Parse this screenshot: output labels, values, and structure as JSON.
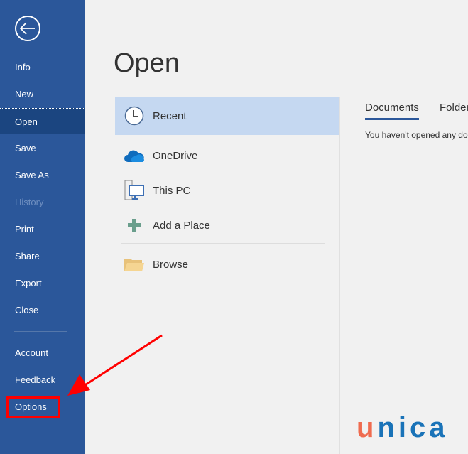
{
  "sidebar": {
    "items": [
      {
        "label": "Info"
      },
      {
        "label": "New"
      },
      {
        "label": "Open",
        "active": true
      },
      {
        "label": "Save"
      },
      {
        "label": "Save As"
      },
      {
        "label": "History",
        "disabled": true
      },
      {
        "label": "Print"
      },
      {
        "label": "Share"
      },
      {
        "label": "Export"
      },
      {
        "label": "Close"
      },
      {
        "label": "Account"
      },
      {
        "label": "Feedback"
      },
      {
        "label": "Options"
      }
    ]
  },
  "main": {
    "title": "Open",
    "places": [
      {
        "label": "Recent",
        "icon": "clock-icon"
      },
      {
        "label": "OneDrive",
        "icon": "cloud-icon"
      },
      {
        "label": "This PC",
        "icon": "computer-icon"
      },
      {
        "label": "Add a Place",
        "icon": "plus-icon"
      },
      {
        "label": "Browse",
        "icon": "folder-icon"
      }
    ],
    "tabs": [
      {
        "label": "Documents"
      },
      {
        "label": "Folder"
      }
    ],
    "empty_message": "You haven't opened any do"
  },
  "watermark": {
    "u": "u",
    "rest": "nica"
  },
  "colors": {
    "sidebar": "#2b579a",
    "accent": "#c5d8f1",
    "annotation": "#ff0000"
  }
}
